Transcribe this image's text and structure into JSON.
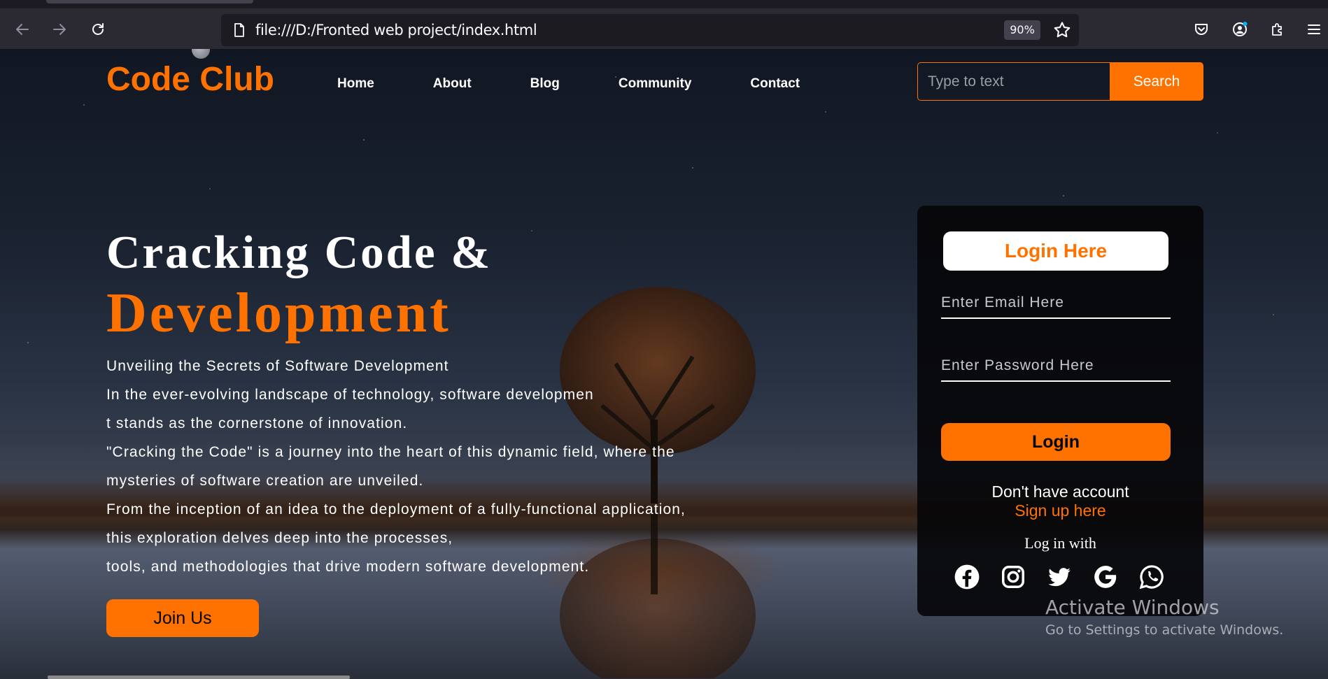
{
  "browser": {
    "url": "file:///D:/Fronted web project/index.html",
    "zoom": "90%",
    "icons": [
      "back-icon",
      "forward-icon",
      "reload-icon",
      "page-icon",
      "bookmark-star-icon",
      "pocket-icon",
      "account-icon",
      "extensions-icon",
      "menu-icon"
    ]
  },
  "nav": {
    "brand": "Code Club",
    "links": [
      "Home",
      "About",
      "Blog",
      "Community",
      "Contact"
    ],
    "search_placeholder": "Type to text",
    "search_button": "Search"
  },
  "hero": {
    "title_line1": "Cracking Code &",
    "title_line2": "Development",
    "lines": [
      "Unveiling the Secrets of Software Development",
      "In the ever-evolving landscape of technology, software developmen",
      "t stands as the cornerstone of innovation.",
      "\"Cracking the Code\" is a journey into the heart of this dynamic field, where the",
      "mysteries of software creation are unveiled.",
      "From the inception of an idea to the deployment of a fully-functional application,",
      "this exploration delves deep into the processes,",
      "tools, and methodologies that drive modern software development."
    ],
    "join_button": "Join Us"
  },
  "login": {
    "title": "Login Here",
    "email_placeholder": "Enter Email Here",
    "password_placeholder": "Enter Password Here",
    "login_button": "Login",
    "no_account": "Don't have account",
    "signup_link": "Sign up here",
    "login_with": "Log in with",
    "social_icons": [
      "facebook-icon",
      "instagram-icon",
      "twitter-icon",
      "google-icon",
      "whatsapp-icon"
    ]
  },
  "watermark": {
    "title": "Activate Windows",
    "subtitle": "Go to Settings to activate Windows."
  },
  "colors": {
    "accent": "#ff7200",
    "card_bg": "#060709",
    "toolbar_bg": "#2b2a33"
  }
}
